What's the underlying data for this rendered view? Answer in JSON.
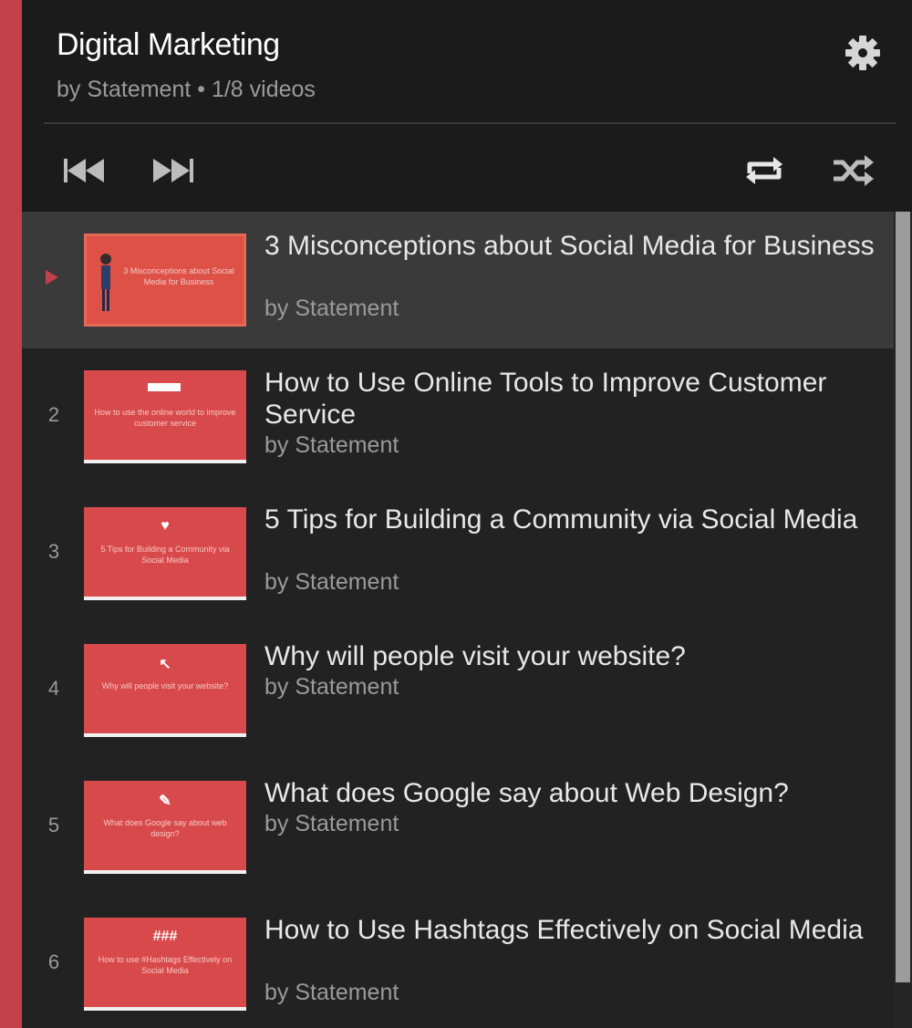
{
  "playlist": {
    "title": "Digital Marketing",
    "subtitle": "by Statement • 1/8 videos"
  },
  "controls": {
    "icons": [
      "skip-previous-icon",
      "skip-next-icon",
      "repeat-icon",
      "shuffle-icon",
      "gear-icon"
    ]
  },
  "videos": [
    {
      "index": "",
      "title": "3 Misconceptions about Social Media for Business",
      "by": "by Statement",
      "thumb_text": "3 Misconceptions about Social Media for Business",
      "thumb_glyph": ""
    },
    {
      "index": "2",
      "title": "How to Use Online Tools to Improve Customer Service",
      "by": "by Statement",
      "thumb_text": "How to use the online world to improve customer service",
      "thumb_glyph": ""
    },
    {
      "index": "3",
      "title": "5 Tips for Building a Community via Social Media",
      "by": "by Statement",
      "thumb_text": "5 Tips for Building a Community via Social Media",
      "thumb_glyph": "♥"
    },
    {
      "index": "4",
      "title": "Why will people visit your website?",
      "by": "by Statement",
      "thumb_text": "Why will people visit your website?",
      "thumb_glyph": "↖"
    },
    {
      "index": "5",
      "title": "What does Google say about Web Design?",
      "by": "by Statement",
      "thumb_text": "What does Google say about web design?",
      "thumb_glyph": "✎"
    },
    {
      "index": "6",
      "title": "How to Use Hashtags Effectively on Social Media",
      "by": "by Statement",
      "thumb_text": "How to use #Hashtags Effectively on Social Media",
      "thumb_glyph": "###"
    }
  ],
  "colors": {
    "accent": "#c3414a",
    "thumbnail": "#d8494b",
    "active_row": "#3a3a3a"
  }
}
